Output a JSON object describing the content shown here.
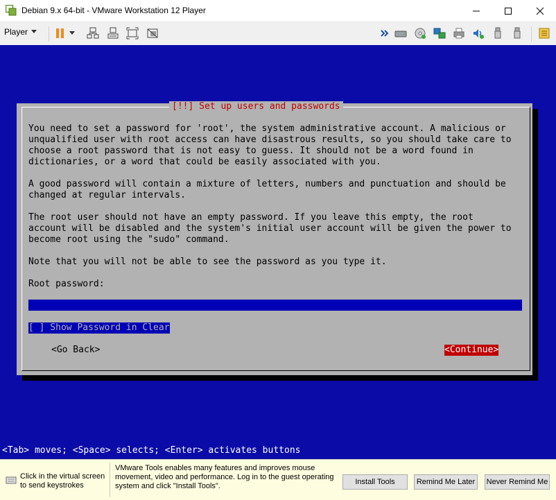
{
  "window": {
    "title": "Debian 9.x 64-bit - VMware Workstation 12 Player"
  },
  "toolbar": {
    "player_label": "Player"
  },
  "dialog": {
    "title": "[!!] Set up users and passwords",
    "paragraphs": [
      "You need to set a password for 'root', the system administrative account. A malicious or\nunqualified user with root access can have disastrous results, so you should take care to\nchoose a root password that is not easy to guess. It should not be a word found in\ndictionaries, or a word that could be easily associated with you.",
      "A good password will contain a mixture of letters, numbers and punctuation and should be\nchanged at regular intervals.",
      "The root user should not have an empty password. If you leave this empty, the root\naccount will be disabled and the system's initial user account will be given the power to\nbecome root using the \"sudo\" command.",
      "Note that you will not be able to see the password as you type it."
    ],
    "field_label": "Root password:",
    "password_value": "***********",
    "show_password": "[ ] Show Password in Clear",
    "go_back": "<Go Back>",
    "continue": "<Continue>"
  },
  "help_line": "<Tab> moves; <Space> selects; <Enter> activates buttons",
  "bottom": {
    "hint": "Click in the virtual screen\nto send keystrokes",
    "message": "VMware Tools enables many features and improves mouse\nmovement, video and performance. Log in to the guest operating\nsystem and click \"Install Tools\".",
    "install_label": "Install Tools",
    "remind_later_label": "Remind Me Later",
    "never_remind_label": "Never Remind Me"
  },
  "colors": {
    "guest_background": "#0b0ba8",
    "dialog_background": "#b2b2b2",
    "dialog_title": "#c00000",
    "selected_button": "#c00000",
    "input_field": "#0000b4",
    "bottom_bar": "#fffde0"
  }
}
